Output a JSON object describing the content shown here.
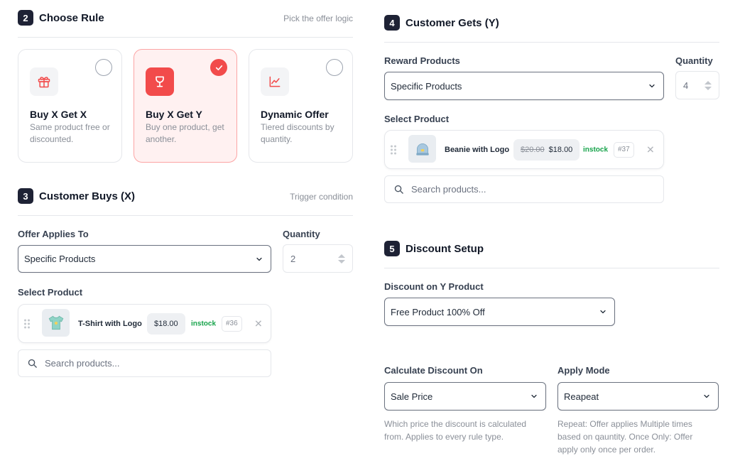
{
  "choose_rule": {
    "step": "2",
    "title": "Choose Rule",
    "hint": "Pick the offer logic",
    "cards": [
      {
        "title": "Buy X Get X",
        "desc": "Same product free or discounted.",
        "selected": false
      },
      {
        "title": "Buy X Get Y",
        "desc": "Buy one product, get another.",
        "selected": true
      },
      {
        "title": "Dynamic Offer",
        "desc": "Tiered discounts by quantity.",
        "selected": false
      }
    ]
  },
  "customer_buys": {
    "step": "3",
    "title": "Customer Buys (X)",
    "hint": "Trigger condition",
    "applies_label": "Offer Applies To",
    "applies_value": "Specific Products",
    "quantity_label": "Quantity",
    "quantity_value": "2",
    "select_label": "Select Product",
    "product": {
      "name": "T-Shirt with Logo",
      "price": "$18.00",
      "stock": "instock",
      "id": "#36"
    },
    "search_placeholder": "Search products..."
  },
  "customer_gets": {
    "step": "4",
    "title": "Customer Gets (Y)",
    "reward_label": "Reward Products",
    "reward_value": "Specific Products",
    "quantity_label": "Quantity",
    "quantity_value": "4",
    "select_label": "Select Product",
    "product": {
      "name": "Beanie with Logo",
      "old_price": "$20.00",
      "price": "$18.00",
      "stock": "instock",
      "id": "#37"
    },
    "search_placeholder": "Search products..."
  },
  "discount_setup": {
    "step": "5",
    "title": "Discount Setup",
    "discount_label": "Discount on Y Product",
    "discount_value": "Free Product 100% Off",
    "calc_label": "Calculate Discount On",
    "calc_value": "Sale Price",
    "calc_help": "Which price the discount is calculated from. Applies to every rule type.",
    "mode_label": "Apply Mode",
    "mode_value": "Reapeat",
    "mode_help": "Repeat: Offer applies Multiple times based on qauntity. Once Only: Offer apply only once per order."
  },
  "colors": {
    "accent": "#f24b4b",
    "badge": "#1e2235",
    "instock": "#16a34a"
  },
  "icons": [
    "gift-icon",
    "trophy-icon",
    "chart-line-icon",
    "check-icon",
    "chevron-down-icon",
    "search-icon",
    "close-icon",
    "drag-handle-icon"
  ]
}
